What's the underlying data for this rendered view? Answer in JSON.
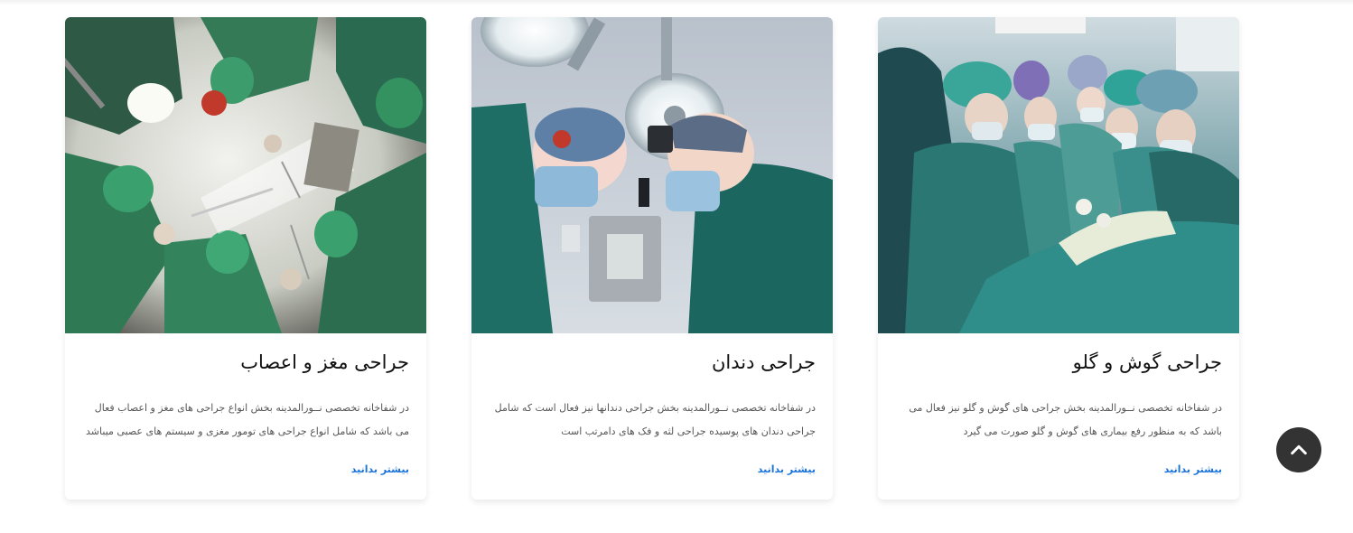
{
  "cards": [
    {
      "title": "جراحی گوش و گلو",
      "text": "در شفاخانه تخصصی نــورالمدینه بخش جراحی های گوش و گلو نیز فعال می باشد که به منظور رفع بیماری های گوش و گلو صورت می گیرد",
      "link": "بیشتر بدانید",
      "image": "surgeons-operating-team-photo"
    },
    {
      "title": "جراحی دندان",
      "text": "در شفاخانه تخصصی نــورالمدینه بخش جراحی دندانها نیز فعال است که شامل جراحی دندان های پوسیده جراحی لثه و فک های دامرتب است",
      "link": "بیشتر بدانید",
      "image": "surgeons-under-operating-lights-photo"
    },
    {
      "title": "جراحی مغز و اعصاب",
      "text": "در شفاخانه تخصصی نــورالمدینه بخش انواع جراحی های مغز و اعصاب فعال می باشد که شامل انواع جراحی های تومور مغزی و سیستم های عصبی میباشد",
      "link": "بیشتر بدانید",
      "image": "surgeons-from-below-photo"
    }
  ],
  "scroll_top": {
    "icon": "chevron-up-icon"
  }
}
